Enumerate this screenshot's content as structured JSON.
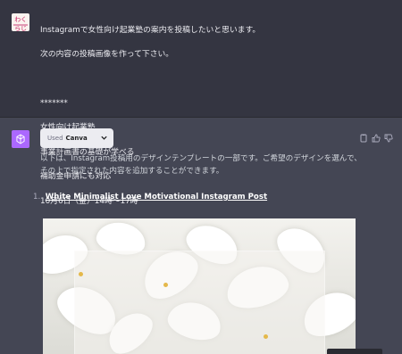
{
  "user": {
    "avatar_logo": "わくらじ",
    "message_lines": [
      "Instagramで女性向け起業塾の案内を投稿したいと思います。",
      "次の内容の投稿画像を作って下さい。",
      "",
      "*******",
      "女性向け起業塾",
      "事業計画書の基礎が学べる",
      "補助金申請にも対応",
      "10月6日（金）14時～17時"
    ]
  },
  "assistant": {
    "avatar_icon": "openai-logo-icon",
    "plugin": {
      "used_label": "Used",
      "name": "Canva"
    },
    "actions": [
      "copy-icon",
      "thumbs-up-icon",
      "thumbs-down-icon"
    ],
    "message": "以下は、Instagram投稿用のデザインテンプレートの一部です。ご希望のデザインを選んで、その上で指定された内容を追加することができます。",
    "list": [
      {
        "number": "1.",
        "title": "White Minimalist Love Motivational Instagram Post"
      }
    ]
  },
  "colors": {
    "user_bg": "#343541",
    "assistant_bg": "#444654",
    "assistant_avatar": "#ab68ff",
    "text": "#ececf1"
  }
}
